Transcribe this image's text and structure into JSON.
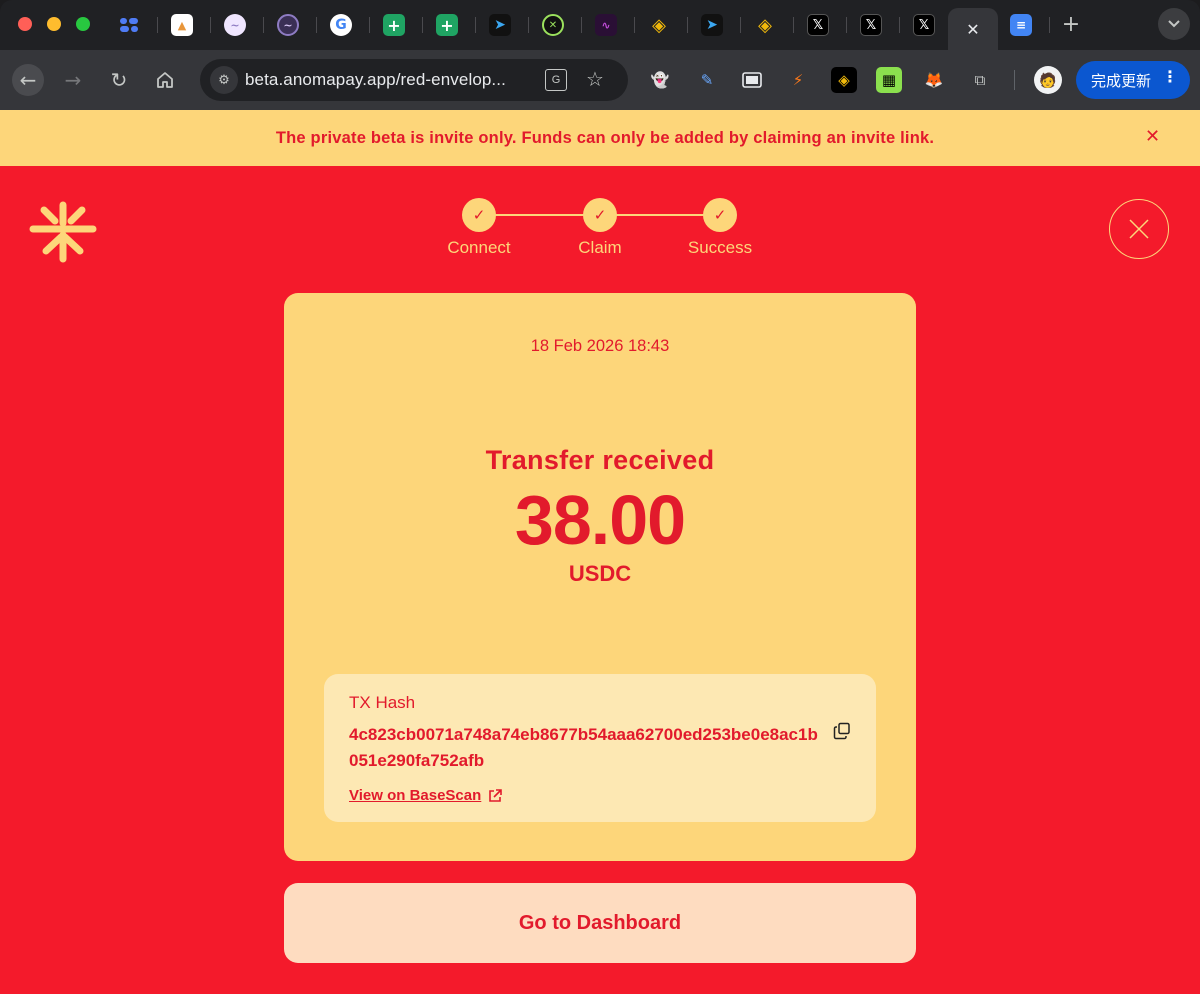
{
  "browser": {
    "tabs": [
      {
        "icon": "app-grid-icon",
        "color": "#4f7cf5"
      },
      {
        "icon": "document-thumbnail-icon",
        "color": "#ffffff"
      },
      {
        "icon": "wave-logo-icon",
        "color": "#d8c6f5"
      },
      {
        "icon": "wave-logo-dark-icon",
        "color": "#8e7cc3"
      },
      {
        "icon": "google-icon",
        "color": "#ffffff"
      },
      {
        "icon": "google-sheets-icon",
        "color": "#1fa463"
      },
      {
        "icon": "google-sheets-icon",
        "color": "#1fa463"
      },
      {
        "icon": "arrow-logo-icon",
        "color": "#3ba7f0"
      },
      {
        "icon": "token-logo-icon",
        "color": "#9be15d"
      },
      {
        "icon": "purple-chart-icon",
        "color": "#5b1f6f"
      },
      {
        "icon": "binance-icon",
        "color": "#f0b90b"
      },
      {
        "icon": "arrow-logo-icon",
        "color": "#3ba7f0"
      },
      {
        "icon": "binance-icon",
        "color": "#f0b90b"
      },
      {
        "icon": "x-logo-icon",
        "color": "#000000"
      },
      {
        "icon": "x-logo-icon",
        "color": "#000000"
      },
      {
        "icon": "x-logo-icon",
        "color": "#000000"
      },
      {
        "icon": "close-icon",
        "color": "#e8eaed"
      },
      {
        "icon": "google-docs-icon",
        "color": "#4285f4"
      }
    ],
    "url": "beta.anomapay.app/red-envelop...",
    "update_button": "完成更新"
  },
  "banner": {
    "text": "The private beta is invite only. Funds can only be added by claiming an invite link."
  },
  "stepper": {
    "steps": [
      {
        "label": "Connect",
        "status": "complete"
      },
      {
        "label": "Claim",
        "status": "complete"
      },
      {
        "label": "Success",
        "status": "complete"
      }
    ]
  },
  "receipt": {
    "date": "18 Feb 2026 18:43",
    "title": "Transfer received",
    "amount": "38.00",
    "currency": "USDC",
    "tx_label": "TX Hash",
    "tx_hash": "4c823cb0071a748a74eb8677b54aaa62700ed253be0e8ac1b051e290fa752afb",
    "explorer_link": "View on BaseScan"
  },
  "actions": {
    "dashboard_button": "Go to Dashboard"
  },
  "colors": {
    "brand_red": "#f41a2b",
    "brand_yellow": "#fdd67a",
    "text_red": "#e21a2c"
  }
}
